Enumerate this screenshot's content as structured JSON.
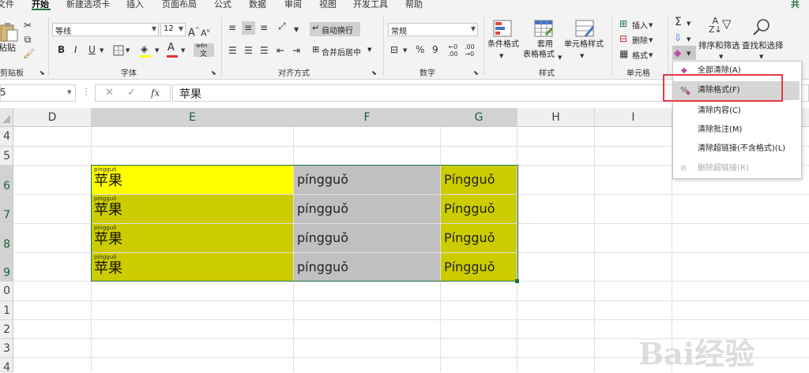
{
  "menu": [
    "文件",
    "开始",
    "新建选项卡",
    "插入",
    "页面布局",
    "公式",
    "数据",
    "审阅",
    "视图",
    "开发工具",
    "帮助"
  ],
  "share_fragment": "共",
  "ribbon": {
    "clipboard": {
      "paste_label": "粘贴",
      "group_label": "剪贴板"
    },
    "font": {
      "font_name": "等线",
      "font_size": "12",
      "bold": "B",
      "italic": "I",
      "underline": "U",
      "grow": "A",
      "shrink": "A",
      "phonetic": "wén",
      "group_label": "字体",
      "font_color": "#e03030",
      "fill_color": "#ffff00"
    },
    "alignment": {
      "wrap_text": "自动换行",
      "merge_center": "合并后居中",
      "group_label": "对齐方式"
    },
    "number": {
      "format": "常规",
      "percent": "%",
      "comma": "9",
      "group_label": "数字"
    },
    "styles": {
      "conditional": "条件格式",
      "table_line1": "套用",
      "table_line2": "表格格式",
      "cell_styles": "单元格样式",
      "group_label": "样式"
    },
    "cells": {
      "insert": "插入",
      "delete": "删除",
      "format": "格式",
      "group_label": "单元格"
    },
    "editing": {
      "sort_filter": "排序和筛选",
      "find_select": "查找和选择"
    }
  },
  "formula_bar": {
    "name_box": "5",
    "fx": "fx",
    "value": "苹果"
  },
  "columns": [
    "D",
    "E",
    "F",
    "G",
    "H",
    "I"
  ],
  "rows": [
    "4",
    "5",
    "6",
    "7",
    "8",
    "9",
    "0",
    "1",
    "2",
    "3",
    "4"
  ],
  "cells": [
    {
      "phonetic": "píngguǒ",
      "chinese": "苹果",
      "pinyin_lower": "píngguǒ",
      "pinyin_upper": "Píngguǒ"
    },
    {
      "phonetic": "píngguǒ",
      "chinese": "苹果",
      "pinyin_lower": "píngguǒ",
      "pinyin_upper": "Píngguǒ"
    },
    {
      "phonetic": "píngguǒ",
      "chinese": "苹果",
      "pinyin_lower": "píngguǒ",
      "pinyin_upper": "Píngguǒ"
    },
    {
      "phonetic": "píngguǒ",
      "chinese": "苹果",
      "pinyin_lower": "píngguǒ",
      "pinyin_upper": "Píngguǒ"
    }
  ],
  "colors": {
    "yellow": "#ffff00",
    "olive": "#cccc00",
    "gray": "#c0c0c0",
    "accent": "#217346"
  },
  "clear_menu": [
    "全部清除(A)",
    "清除格式(F)",
    "清除内容(C)",
    "清除批注(M)",
    "清除超链接(不含格式)(L)",
    "删除超链接(R)"
  ],
  "watermark": "Bai经验"
}
